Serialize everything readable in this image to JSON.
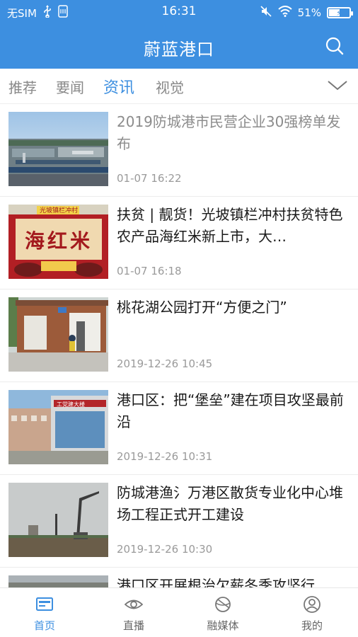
{
  "status_bar": {
    "carrier": "无SIM",
    "time": "16:31",
    "battery": "51%",
    "battery_level": 0.51
  },
  "header": {
    "title": "蔚蓝港口"
  },
  "tabs": [
    {
      "label": "推荐"
    },
    {
      "label": "要闻"
    },
    {
      "label": "资讯",
      "active": true
    },
    {
      "label": "视觉"
    }
  ],
  "feed": [
    {
      "title": "2019防城港市民营企业30强榜单发布",
      "time": "01-07 16:22",
      "read": true
    },
    {
      "title": "扶贫 | 靓货！光坡镇栏冲村扶贫特色农产品海红米新上市，大…",
      "time": "01-07 16:18",
      "thumb_text": "海红米",
      "thumb_banner": "光坡镇栏冲村"
    },
    {
      "title": "桃花湖公园打开“方便之门”",
      "time": "2019-12-26 10:45"
    },
    {
      "title": "港口区：把“堡垒”建在项目攻坚最前沿",
      "time": "2019-12-26 10:31",
      "thumb_sign": "工党建大楼"
    },
    {
      "title": "防城港渔氵万港区散货专业化中心堆场工程正式开工建设",
      "time": "2019-12-26 10:30"
    },
    {
      "title": "港口区开展根治欠薪冬季攻坚行",
      "time": ""
    }
  ],
  "bottom_nav": [
    {
      "label": "首页",
      "icon": "home-icon",
      "active": true
    },
    {
      "label": "直播",
      "icon": "eye-icon"
    },
    {
      "label": "融媒体",
      "icon": "globe-icon"
    },
    {
      "label": "我的",
      "icon": "user-icon"
    }
  ],
  "colors": {
    "primary": "#3d8fe0",
    "text": "#1a1a1a",
    "muted": "#9a9a9a"
  }
}
